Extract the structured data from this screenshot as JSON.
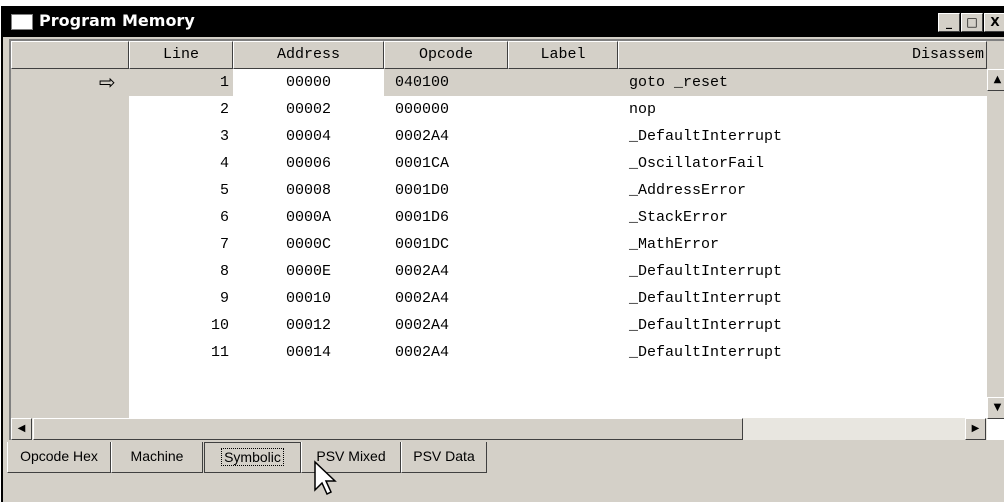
{
  "window": {
    "title": "Program Memory",
    "controls": {
      "minimize": "_",
      "maximize": "□",
      "close": "X"
    }
  },
  "columns": [
    "Line",
    "Address",
    "Opcode",
    "Label",
    "Disassem"
  ],
  "rows": [
    {
      "line": "1",
      "address": "00000",
      "opcode": "040100",
      "label": "",
      "disassembly": "goto _reset",
      "current": true
    },
    {
      "line": "2",
      "address": "00002",
      "opcode": "000000",
      "label": "",
      "disassembly": "nop"
    },
    {
      "line": "3",
      "address": "00004",
      "opcode": "0002A4",
      "label": "",
      "disassembly": "_DefaultInterrupt"
    },
    {
      "line": "4",
      "address": "00006",
      "opcode": "0001CA",
      "label": "",
      "disassembly": "_OscillatorFail"
    },
    {
      "line": "5",
      "address": "00008",
      "opcode": "0001D0",
      "label": "",
      "disassembly": "_AddressError"
    },
    {
      "line": "6",
      "address": "0000A",
      "opcode": "0001D6",
      "label": "",
      "disassembly": "_StackError"
    },
    {
      "line": "7",
      "address": "0000C",
      "opcode": "0001DC",
      "label": "",
      "disassembly": "_MathError"
    },
    {
      "line": "8",
      "address": "0000E",
      "opcode": "0002A4",
      "label": "",
      "disassembly": "_DefaultInterrupt"
    },
    {
      "line": "9",
      "address": "00010",
      "opcode": "0002A4",
      "label": "",
      "disassembly": "_DefaultInterrupt"
    },
    {
      "line": "10",
      "address": "00012",
      "opcode": "0002A4",
      "label": "",
      "disassembly": "_DefaultInterrupt"
    },
    {
      "line": "11",
      "address": "00014",
      "opcode": "0002A4",
      "label": "",
      "disassembly": "_DefaultInterrupt"
    }
  ],
  "current_marker_icon": "right-arrow-icon",
  "tabs": [
    "Opcode Hex",
    "Machine",
    "Symbolic",
    "PSV Mixed",
    "PSV Data"
  ],
  "active_tab": "Symbolic",
  "colors": {
    "titlebar": "#000000",
    "chrome": "#d4d0c8",
    "current_row": "#d4d0c8"
  }
}
